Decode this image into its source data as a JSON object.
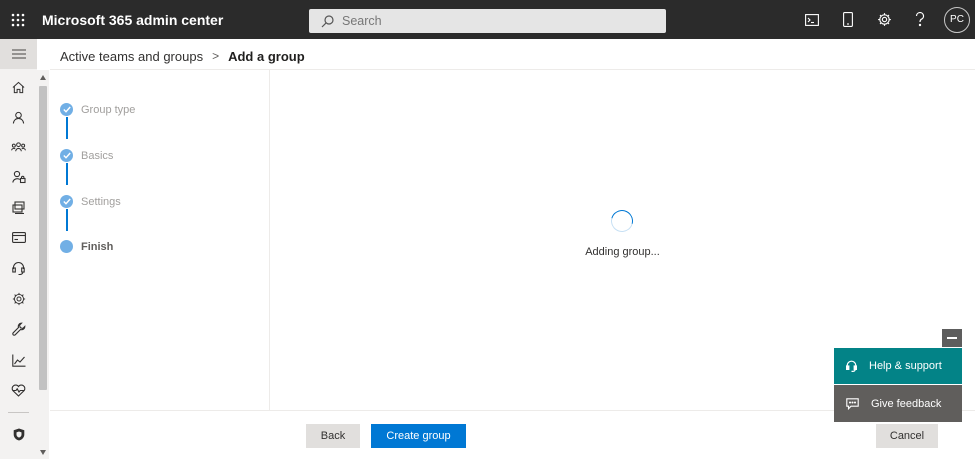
{
  "topbar": {
    "app_title": "Microsoft 365 admin center",
    "search_placeholder": "Search",
    "avatar_initials": "PC"
  },
  "breadcrumb": {
    "parent": "Active teams and groups",
    "separator": ">",
    "current": "Add a group"
  },
  "wizard": {
    "steps": [
      {
        "label": "Group type",
        "state": "completed"
      },
      {
        "label": "Basics",
        "state": "completed"
      },
      {
        "label": "Settings",
        "state": "completed"
      },
      {
        "label": "Finish",
        "state": "current"
      }
    ]
  },
  "content": {
    "status_text": "Adding group..."
  },
  "footer": {
    "back_label": "Back",
    "create_label": "Create group",
    "cancel_label": "Cancel"
  },
  "help_panel": {
    "help_label": "Help & support",
    "feedback_label": "Give feedback"
  },
  "colors": {
    "topbar": "#2b2b2b",
    "primary": "#0078d4",
    "step_completed": "#71afe5",
    "help_teal": "#038387",
    "feedback_gray": "#605e5c"
  },
  "nav_icons": [
    "home-icon",
    "user-icon",
    "teams-icon",
    "roles-icon",
    "resources-icon",
    "billing-icon",
    "support-icon",
    "settings-icon",
    "setup-icon",
    "reports-icon",
    "health-icon",
    "security-icon"
  ]
}
